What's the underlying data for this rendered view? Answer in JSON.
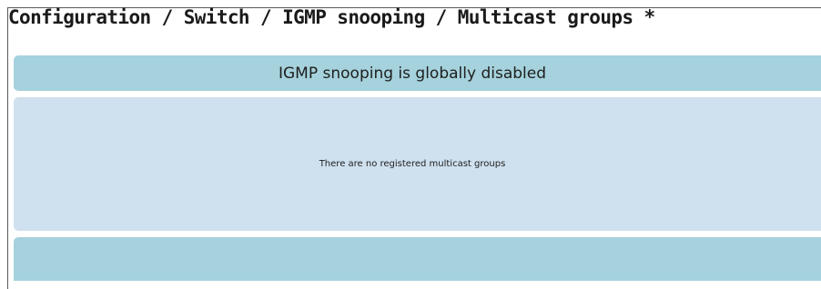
{
  "page": {
    "title": "Configuration / Switch / IGMP snooping / Multicast groups *"
  },
  "status": {
    "message": "IGMP snooping is globally disabled"
  },
  "groups_panel": {
    "empty_message": "There are no registered multicast groups"
  },
  "colors": {
    "banner": "#a5d2dc",
    "panel": "#cfe0ee",
    "frame_border": "#5a5a5a"
  }
}
